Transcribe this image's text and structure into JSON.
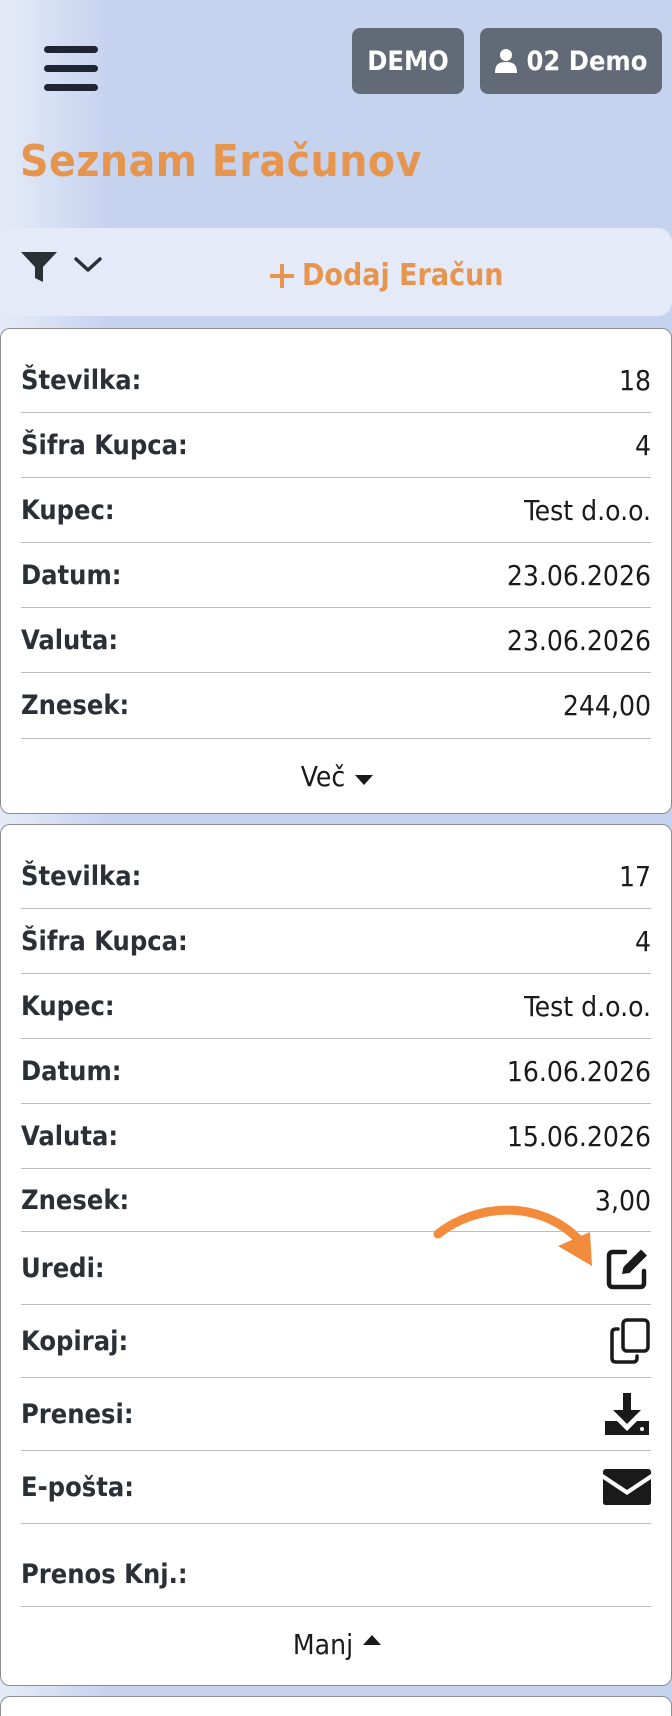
{
  "header": {
    "menu_icon": "hamburger-menu-icon",
    "demo_label": "DEMO",
    "user_label": "02 Demo",
    "user_icon": "user-icon"
  },
  "page_title": "Seznam Eračunov",
  "toolbar": {
    "filter_icon": "filter-icon",
    "chevron_icon": "chevron-down-icon",
    "add_label": "Dodaj Eračun"
  },
  "cards": [
    {
      "rows": [
        {
          "label": "Številka:",
          "value": "18"
        },
        {
          "label": "Šifra Kupca:",
          "value": "4"
        },
        {
          "label": "Kupec:",
          "value": "Test d.o.o."
        },
        {
          "label": "Datum:",
          "value": "23.06.2026"
        },
        {
          "label": "Valuta:",
          "value": "23.06.2026"
        },
        {
          "label": "Znesek:",
          "value": "244,00"
        }
      ],
      "toggle_label": "Več"
    },
    {
      "rows": [
        {
          "label": "Številka:",
          "value": "17"
        },
        {
          "label": "Šifra Kupca:",
          "value": "4"
        },
        {
          "label": "Kupec:",
          "value": "Test d.o.o."
        },
        {
          "label": "Datum:",
          "value": "16.06.2026"
        },
        {
          "label": "Valuta:",
          "value": "15.06.2026"
        },
        {
          "label": "Znesek:",
          "value": "3,00"
        }
      ],
      "actions": [
        {
          "label": "Uredi:",
          "icon": "edit-icon"
        },
        {
          "label": "Kopiraj:",
          "icon": "copy-icon"
        },
        {
          "label": "Prenesi:",
          "icon": "download-icon"
        },
        {
          "label": "E-pošta:",
          "icon": "email-icon"
        }
      ],
      "transfer_label": "Prenos Knj.:",
      "toggle_label": "Manj"
    }
  ],
  "colors": {
    "accent": "#e6954f",
    "background": "#c6d3ef",
    "button": "#626a78"
  }
}
